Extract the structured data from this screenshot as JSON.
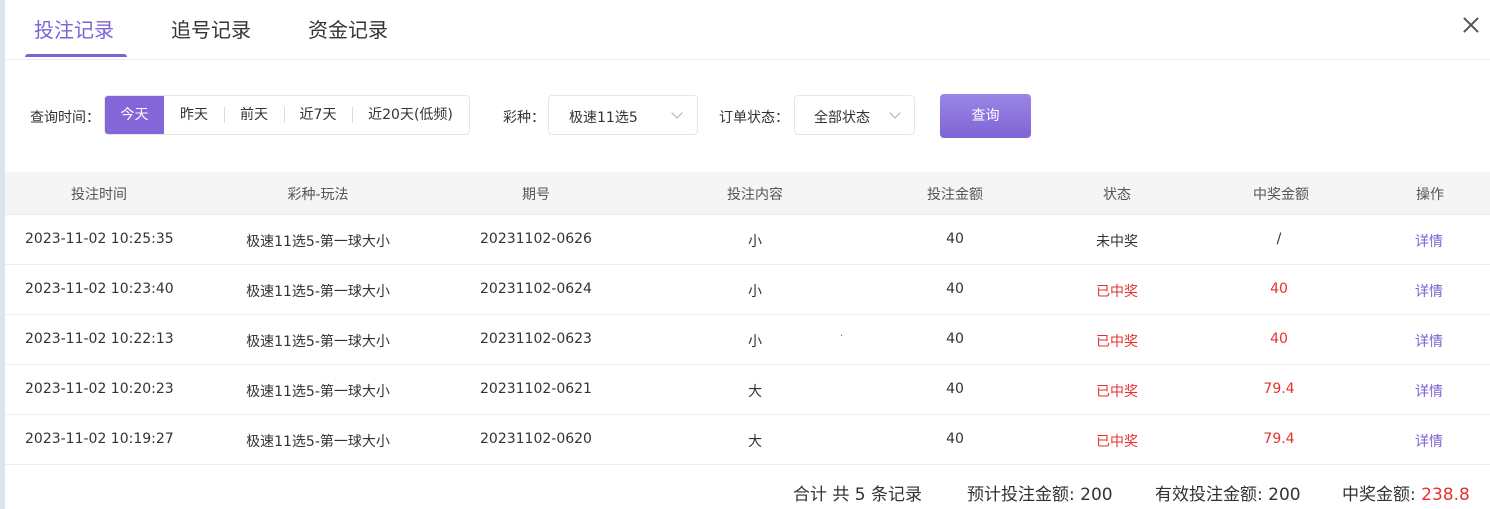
{
  "tabs": [
    {
      "label": "投注记录",
      "active": true
    },
    {
      "label": "追号记录",
      "active": false
    },
    {
      "label": "资金记录",
      "active": false
    }
  ],
  "accent_color": "#7b62d6",
  "win_color": "#e5322d",
  "filter": {
    "time_label": "查询时间：",
    "time_options": [
      "今天",
      "昨天",
      "前天",
      "近7天",
      "近20天(低频)"
    ],
    "time_selected": "今天",
    "lottery_label": "彩种：",
    "lottery_value": "极速11选5",
    "status_label": "订单状态：",
    "status_value": "全部状态",
    "query_button": "查询"
  },
  "table": {
    "headers": [
      "投注时间",
      "彩种-玩法",
      "期号",
      "投注内容",
      "投注金额",
      "状态",
      "中奖金额",
      "操作"
    ],
    "rows": [
      {
        "time": "2023-11-02 10:25:35",
        "game": "极速11选5-第一球大小",
        "issue": "20231102-0626",
        "content": "小",
        "amount": "40",
        "status": "未中奖",
        "prize": "/",
        "action": "详情",
        "won": false
      },
      {
        "time": "2023-11-02 10:23:40",
        "game": "极速11选5-第一球大小",
        "issue": "20231102-0624",
        "content": "小",
        "amount": "40",
        "status": "已中奖",
        "prize": "40",
        "action": "详情",
        "won": true
      },
      {
        "time": "2023-11-02 10:22:13",
        "game": "极速11选5-第一球大小",
        "issue": "20231102-0623",
        "content": "小",
        "amount": "40",
        "status": "已中奖",
        "prize": "40",
        "action": "详情",
        "won": true
      },
      {
        "time": "2023-11-02 10:20:23",
        "game": "极速11选5-第一球大小",
        "issue": "20231102-0621",
        "content": "大",
        "amount": "40",
        "status": "已中奖",
        "prize": "79.4",
        "action": "详情",
        "won": true
      },
      {
        "time": "2023-11-02 10:19:27",
        "game": "极速11选5-第一球大小",
        "issue": "20231102-0620",
        "content": "大",
        "amount": "40",
        "status": "已中奖",
        "prize": "79.4",
        "action": "详情",
        "won": true
      }
    ]
  },
  "summary": {
    "total": "合计 共 5 条记录",
    "expected_label": "预计投注金额:",
    "expected_value": "200",
    "valid_label": "有效投注金额:",
    "valid_value": "200",
    "prize_label": "中奖金额:",
    "prize_value": "238.8"
  }
}
